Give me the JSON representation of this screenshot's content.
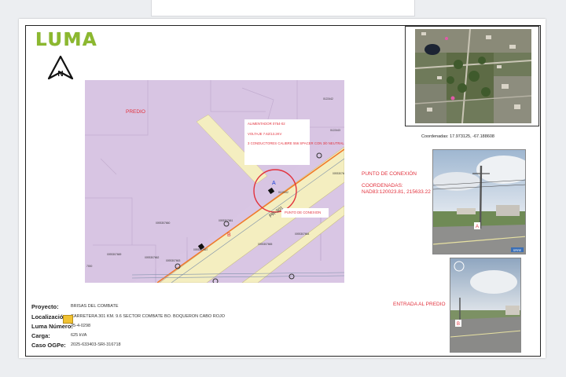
{
  "document": {
    "logo_text": "LUMA",
    "map_labels": {
      "predio": "PREDIO",
      "alimentador": "ALIMENTADOR 0754-02",
      "voltaje": "VOLTAJE 7.62/13.2KV",
      "conductores": "3 CONDUCTORES CALIBRE 556 SPACER CON 3/0 NEUTRAL",
      "punto_label": "PUNTO DE CONEXION",
      "road_name": "PR-301",
      "point_a": "A",
      "point_b": "B",
      "pole_top": "0122442",
      "pole_right": "0122443",
      "pole_1": "0122442",
      "pole_2": "0093307660",
      "pole_3": "0093307661",
      "pole_4": "0093307667",
      "pole_5": "0093307669",
      "pole_6": "0093307662",
      "pole_7": "0093307663",
      "pole_8": "0093307664",
      "pole_9": "0093307665",
      "pole_10": "0093307666",
      "pole_11": "7000"
    },
    "coordinates_label": "Coordenadas:",
    "coordinates_value": "17.973125, -67.188608",
    "punto_conexion": "PUNTO DE CONEXIÓN",
    "coordenadas_heading": "COORDENADAS:",
    "nad83": "NAD83:120023.81, 215633.22",
    "entrada": "ENTRADA AL PREDIO",
    "photo_a_marker": "A",
    "photo_b_marker": "B",
    "photo_a_tag": "SPIRE",
    "info": {
      "proyecto_label": "Proyecto:",
      "proyecto": "BRISAS DEL COMBATE",
      "localizacion_label": "Localización:",
      "localizacion": "CARRETERA 301 KM. 9.6 SECTOR COMBATE BO. BOQUERON CABO ROJO",
      "luma_label": "Luma Número:",
      "luma": "25-4-0298",
      "carga_label": "Carga:",
      "carga": "625 kVA",
      "caso_label": "Caso OGPe:",
      "caso": "2025-633403-SRI-316718"
    }
  }
}
